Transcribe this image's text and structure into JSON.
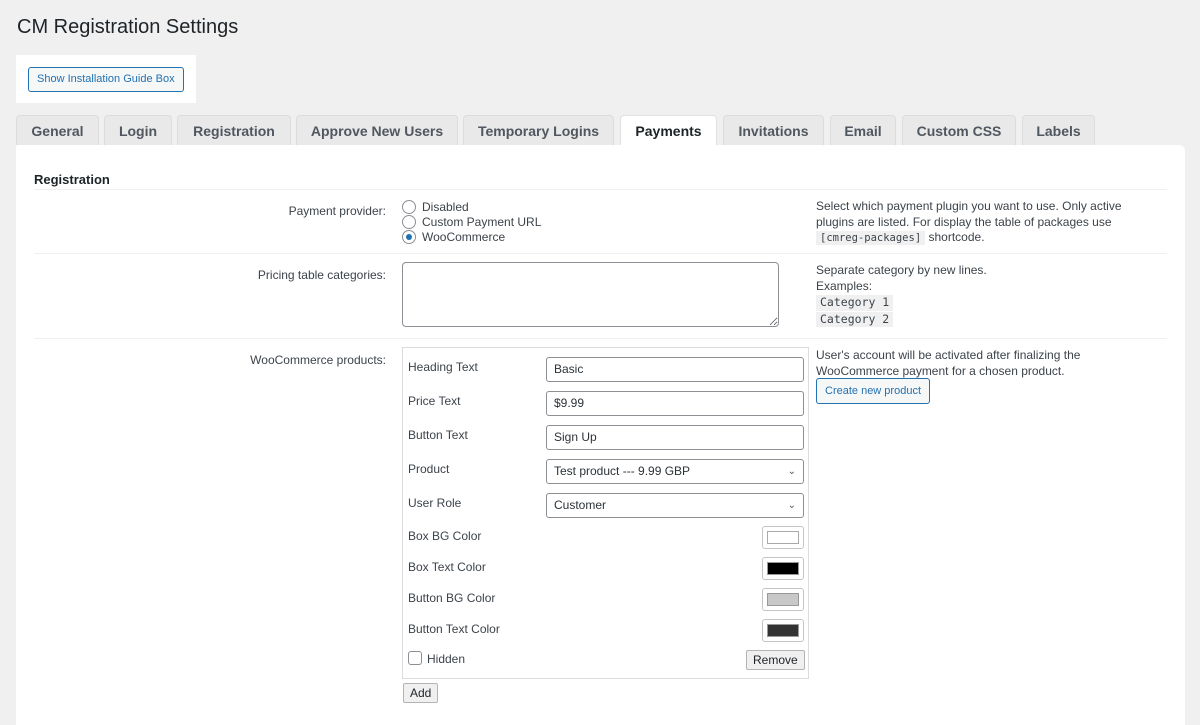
{
  "page": {
    "title": "CM Registration Settings",
    "guide_button": "Show Installation Guide Box"
  },
  "tabs": [
    {
      "label": "General",
      "active": false
    },
    {
      "label": "Login",
      "active": false
    },
    {
      "label": "Registration",
      "active": false
    },
    {
      "label": "Approve New Users",
      "active": false
    },
    {
      "label": "Temporary Logins",
      "active": false
    },
    {
      "label": "Payments",
      "active": true
    },
    {
      "label": "Invitations",
      "active": false
    },
    {
      "label": "Email",
      "active": false
    },
    {
      "label": "Custom CSS",
      "active": false
    },
    {
      "label": "Labels",
      "active": false
    }
  ],
  "section": {
    "title": "Registration"
  },
  "payment_provider": {
    "label": "Payment provider:",
    "options": [
      "Disabled",
      "Custom Payment URL",
      "WooCommerce"
    ],
    "selected": "WooCommerce",
    "desc_text": "Select which payment plugin you want to use. Only active plugins are listed. For display the table of packages use",
    "desc_code": "[cmreg-packages]",
    "desc_suffix": "shortcode."
  },
  "pricing_categories": {
    "label": "Pricing table categories:",
    "value": "",
    "desc_line1": "Separate category by new lines.",
    "desc_line2": "Examples:",
    "examples": [
      "Category 1",
      "Category 2"
    ]
  },
  "woo_products": {
    "label": "WooCommerce products:",
    "fields": {
      "heading_label": "Heading Text",
      "heading_value": "Basic",
      "price_label": "Price Text",
      "price_value": "$9.99",
      "button_label": "Button Text",
      "button_value": "Sign Up",
      "product_label": "Product",
      "product_value": "Test product --- 9.99 GBP",
      "role_label": "User Role",
      "role_value": "Customer"
    },
    "colors": [
      {
        "label": "Box BG Color",
        "value": "#ffffff"
      },
      {
        "label": "Box Text Color",
        "value": "#000000"
      },
      {
        "label": "Button BG Color",
        "value": "#c8c8c8"
      },
      {
        "label": "Button Text Color",
        "value": "#333333"
      }
    ],
    "hidden_label": "Hidden",
    "hidden_checked": false,
    "remove_label": "Remove",
    "add_label": "Add",
    "desc": "User's account will be activated after finalizing the WooCommerce payment for a chosen product.",
    "create_button": "Create new product"
  }
}
